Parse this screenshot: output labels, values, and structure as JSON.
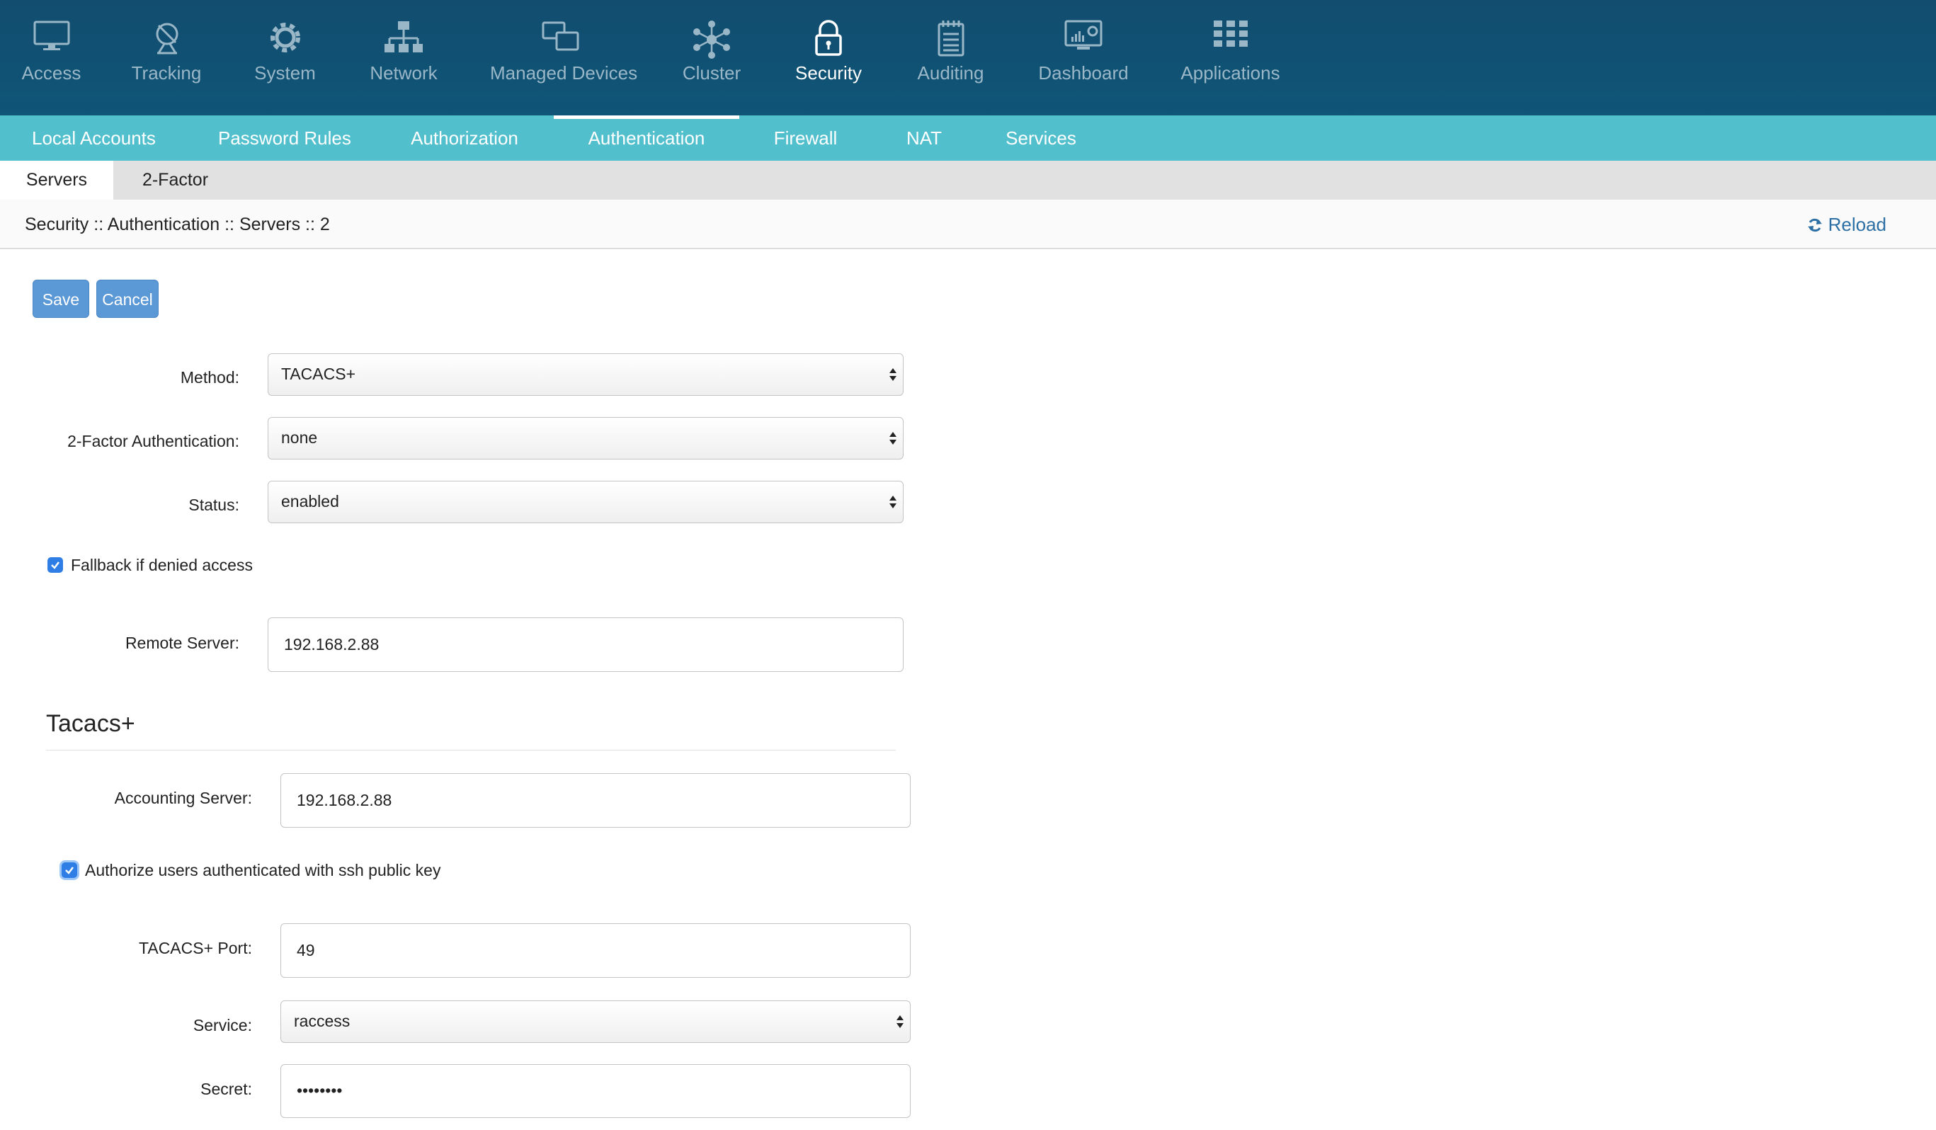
{
  "nav": {
    "items": [
      {
        "label": "Access",
        "icon": "monitor-icon"
      },
      {
        "label": "Tracking",
        "icon": "satellite-icon"
      },
      {
        "label": "System",
        "icon": "gear-icon"
      },
      {
        "label": "Network",
        "icon": "network-icon"
      },
      {
        "label": "Managed Devices",
        "icon": "devices-icon"
      },
      {
        "label": "Cluster",
        "icon": "cluster-icon"
      },
      {
        "label": "Security",
        "icon": "lock-icon",
        "active": true
      },
      {
        "label": "Auditing",
        "icon": "notepad-icon"
      },
      {
        "label": "Dashboard",
        "icon": "dashboard-icon"
      },
      {
        "label": "Applications",
        "icon": "grid-icon"
      }
    ]
  },
  "subnav": {
    "items": [
      {
        "label": "Local Accounts"
      },
      {
        "label": "Password Rules"
      },
      {
        "label": "Authorization"
      },
      {
        "label": "Authentication",
        "active": true
      },
      {
        "label": "Firewall"
      },
      {
        "label": "NAT"
      },
      {
        "label": "Services"
      }
    ]
  },
  "tabs": [
    {
      "label": "Servers",
      "active": true
    },
    {
      "label": "2-Factor"
    }
  ],
  "breadcrumb": "Security :: Authentication :: Servers :: 2",
  "reload_label": "Reload",
  "buttons": {
    "save": "Save",
    "cancel": "Cancel"
  },
  "form": {
    "method": {
      "label": "Method:",
      "value": "TACACS+"
    },
    "two_factor": {
      "label": "2-Factor Authentication:",
      "value": "none"
    },
    "status": {
      "label": "Status:",
      "value": "enabled"
    },
    "fallback": {
      "label": "Fallback if denied access",
      "checked": true
    },
    "remote_server": {
      "label": "Remote Server:",
      "value": "192.168.2.88"
    }
  },
  "tacacs": {
    "title": "Tacacs+",
    "accounting_server": {
      "label": "Accounting Server:",
      "value": "192.168.2.88"
    },
    "authorize_ssh": {
      "label": "Authorize users authenticated with ssh public key",
      "checked": true
    },
    "port": {
      "label": "TACACS+ Port:",
      "value": "49"
    },
    "service": {
      "label": "Service:",
      "value": "raccess"
    },
    "secret": {
      "label": "Secret:",
      "value": "••••••••"
    }
  },
  "colors": {
    "topnav": "#0f5577",
    "subnav": "#52bfcd",
    "button": "#5a98d6",
    "checkbox": "#2f7ee6",
    "link": "#2b6fa5"
  }
}
